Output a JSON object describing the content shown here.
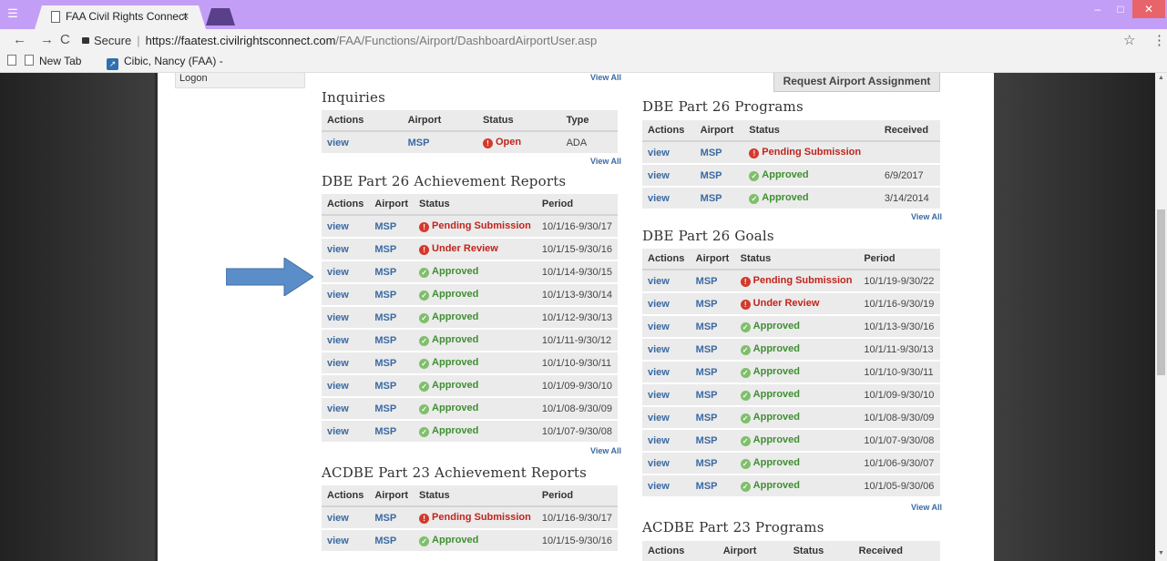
{
  "browser": {
    "tab_title": "FAA Civil Rights Connect",
    "tab_close": "×",
    "secure_label": "Secure",
    "url_host": "https://faatest.civilrightsconnect.com",
    "url_path": "/FAA/Functions/Airport/DashboardAirportUser.asp",
    "bookmarks": [
      "New Tab",
      "Cibic, Nancy (FAA) -"
    ],
    "window_buttons": [
      "–",
      "□",
      "✕"
    ]
  },
  "page": {
    "sidebar_partial": "Logon",
    "request_button": "Request Airport Assignment",
    "view_all": "View All"
  },
  "inquiries": {
    "title": "Inquiries",
    "headers": [
      "Actions",
      "Airport",
      "Status",
      "Type"
    ],
    "rows": [
      {
        "action": "view",
        "airport": "MSP",
        "status": "Open",
        "type": "ADA",
        "state": "red"
      }
    ]
  },
  "dbe26_reports": {
    "title": "DBE Part 26 Achievement Reports",
    "headers": [
      "Actions",
      "Airport",
      "Status",
      "Period"
    ],
    "rows": [
      {
        "action": "view",
        "airport": "MSP",
        "status": "Pending Submission",
        "period": "10/1/16-9/30/17",
        "state": "red"
      },
      {
        "action": "view",
        "airport": "MSP",
        "status": "Under Review",
        "period": "10/1/15-9/30/16",
        "state": "red"
      },
      {
        "action": "view",
        "airport": "MSP",
        "status": "Approved",
        "period": "10/1/14-9/30/15",
        "state": "green"
      },
      {
        "action": "view",
        "airport": "MSP",
        "status": "Approved",
        "period": "10/1/13-9/30/14",
        "state": "green"
      },
      {
        "action": "view",
        "airport": "MSP",
        "status": "Approved",
        "period": "10/1/12-9/30/13",
        "state": "green"
      },
      {
        "action": "view",
        "airport": "MSP",
        "status": "Approved",
        "period": "10/1/11-9/30/12",
        "state": "green"
      },
      {
        "action": "view",
        "airport": "MSP",
        "status": "Approved",
        "period": "10/1/10-9/30/11",
        "state": "green"
      },
      {
        "action": "view",
        "airport": "MSP",
        "status": "Approved",
        "period": "10/1/09-9/30/10",
        "state": "green"
      },
      {
        "action": "view",
        "airport": "MSP",
        "status": "Approved",
        "period": "10/1/08-9/30/09",
        "state": "green"
      },
      {
        "action": "view",
        "airport": "MSP",
        "status": "Approved",
        "period": "10/1/07-9/30/08",
        "state": "green"
      }
    ]
  },
  "acdbe23_reports": {
    "title": "ACDBE Part 23 Achievement Reports",
    "headers": [
      "Actions",
      "Airport",
      "Status",
      "Period"
    ],
    "rows": [
      {
        "action": "view",
        "airport": "MSP",
        "status": "Pending Submission",
        "period": "10/1/16-9/30/17",
        "state": "red"
      },
      {
        "action": "view",
        "airport": "MSP",
        "status": "Approved",
        "period": "10/1/15-9/30/16",
        "state": "green"
      }
    ]
  },
  "dbe26_programs": {
    "title": "DBE Part 26 Programs",
    "headers": [
      "Actions",
      "Airport",
      "Status",
      "Received"
    ],
    "rows": [
      {
        "action": "view",
        "airport": "MSP",
        "status": "Pending Submission",
        "received": "",
        "state": "red"
      },
      {
        "action": "view",
        "airport": "MSP",
        "status": "Approved",
        "received": "6/9/2017",
        "state": "green"
      },
      {
        "action": "view",
        "airport": "MSP",
        "status": "Approved",
        "received": "3/14/2014",
        "state": "green"
      }
    ]
  },
  "dbe26_goals": {
    "title": "DBE Part 26 Goals",
    "headers": [
      "Actions",
      "Airport",
      "Status",
      "Period"
    ],
    "rows": [
      {
        "action": "view",
        "airport": "MSP",
        "status": "Pending Submission",
        "period": "10/1/19-9/30/22",
        "state": "red"
      },
      {
        "action": "view",
        "airport": "MSP",
        "status": "Under Review",
        "period": "10/1/16-9/30/19",
        "state": "red"
      },
      {
        "action": "view",
        "airport": "MSP",
        "status": "Approved",
        "period": "10/1/13-9/30/16",
        "state": "green"
      },
      {
        "action": "view",
        "airport": "MSP",
        "status": "Approved",
        "period": "10/1/11-9/30/13",
        "state": "green"
      },
      {
        "action": "view",
        "airport": "MSP",
        "status": "Approved",
        "period": "10/1/10-9/30/11",
        "state": "green"
      },
      {
        "action": "view",
        "airport": "MSP",
        "status": "Approved",
        "period": "10/1/09-9/30/10",
        "state": "green"
      },
      {
        "action": "view",
        "airport": "MSP",
        "status": "Approved",
        "period": "10/1/08-9/30/09",
        "state": "green"
      },
      {
        "action": "view",
        "airport": "MSP",
        "status": "Approved",
        "period": "10/1/07-9/30/08",
        "state": "green"
      },
      {
        "action": "view",
        "airport": "MSP",
        "status": "Approved",
        "period": "10/1/06-9/30/07",
        "state": "green"
      },
      {
        "action": "view",
        "airport": "MSP",
        "status": "Approved",
        "period": "10/1/05-9/30/06",
        "state": "green"
      }
    ]
  },
  "acdbe23_programs": {
    "title": "ACDBE Part 23 Programs",
    "headers": [
      "Actions",
      "Airport",
      "Status",
      "Received"
    ]
  },
  "colors": {
    "titlebar": "#c39ef7",
    "link": "#3a6aa3",
    "status_red": "#c0241d",
    "status_green": "#3f8f32",
    "arrow": "#5b8ec9"
  }
}
